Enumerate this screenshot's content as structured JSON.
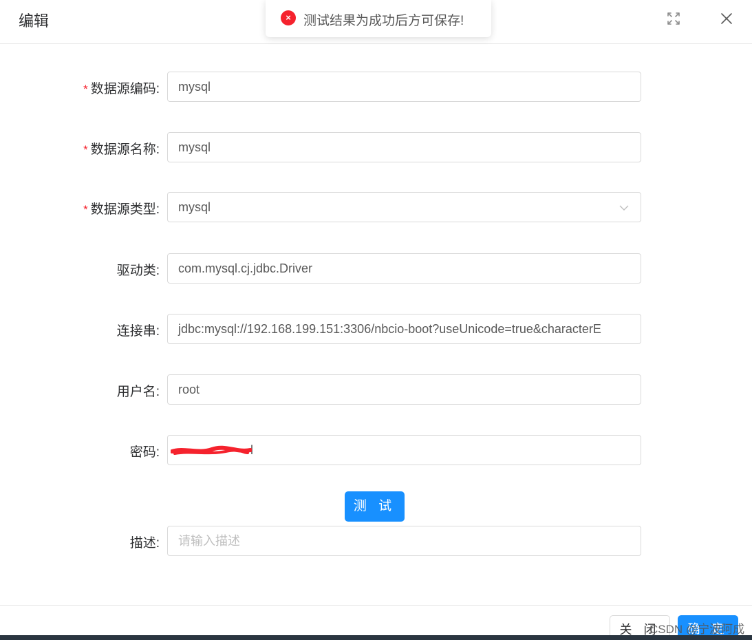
{
  "dialog": {
    "title": "编辑"
  },
  "toast": {
    "message": "测试结果为成功后方可保存!",
    "icon": "error-circle-icon",
    "icon_glyph": "×"
  },
  "form": {
    "required_mark": "*",
    "fields": [
      {
        "label": "数据源编码:",
        "value": "mysql",
        "required": true
      },
      {
        "label": "数据源名称:",
        "value": "mysql",
        "required": true
      },
      {
        "label": "数据源类型:",
        "value": "mysql",
        "required": true
      },
      {
        "label": "驱动类:",
        "value": "com.mysql.cj.jdbc.Driver",
        "required": false
      },
      {
        "label": "连接串:",
        "value": "jdbc:mysql://192.168.199.151:3306/nbcio-boot?useUnicode=true&characterE",
        "required": false
      },
      {
        "label": "用户名:",
        "value": "root",
        "required": false
      },
      {
        "label": "密码:",
        "value": "l",
        "required": false
      },
      {
        "label": "描述:",
        "value": "",
        "placeholder": "请输入描述",
        "required": false
      }
    ]
  },
  "buttons": {
    "test": "测 试",
    "close": "关 闭",
    "confirm": "确 定"
  },
  "watermark": "CSDN @宁波阿成",
  "colors": {
    "primary": "#1890ff",
    "error": "#f5222d",
    "redaction": "#f5222d"
  }
}
